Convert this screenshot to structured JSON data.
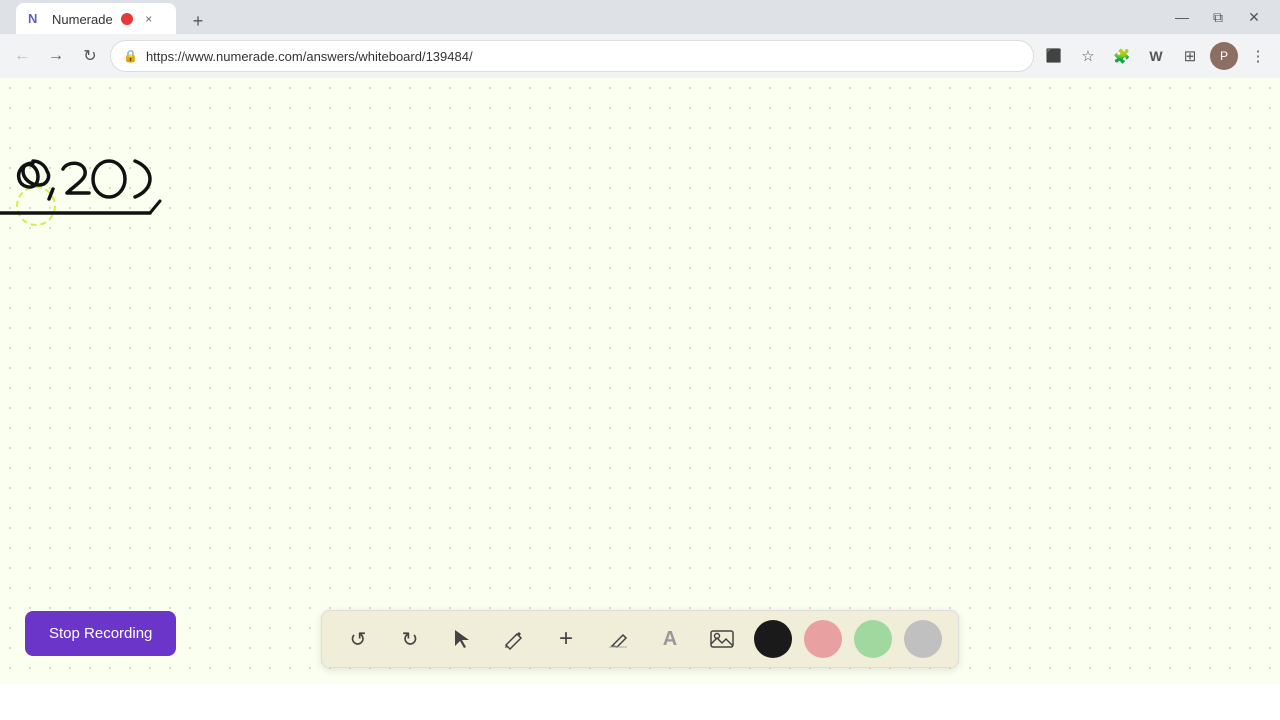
{
  "browser": {
    "tab": {
      "favicon": "N",
      "title": "Numerade",
      "recording_dot": true,
      "close_label": "×"
    },
    "new_tab_label": "+",
    "window_controls": {
      "minimize": "—",
      "maximize": "⧉",
      "close": "✕"
    },
    "nav": {
      "back_label": "←",
      "forward_label": "→",
      "reload_label": "↻",
      "url": "https://www.numerade.com/answers/whiteboard/139484/",
      "bookmark_label": "☆",
      "extensions_label": "⬡",
      "wordmark_label": "W",
      "grid_label": "⊞",
      "profile_label": "P",
      "menu_label": "⋮"
    }
  },
  "toolbar": {
    "undo_label": "↺",
    "redo_label": "↻",
    "select_label": "▲",
    "pen_label": "✏",
    "add_label": "+",
    "eraser_label": "◻",
    "text_label": "A",
    "image_label": "🖼",
    "colors": [
      {
        "name": "black",
        "hex": "#1a1a1a"
      },
      {
        "name": "pink",
        "hex": "#e8a0a0"
      },
      {
        "name": "green",
        "hex": "#a0d8a0"
      },
      {
        "name": "gray",
        "hex": "#c0c0c0"
      }
    ]
  },
  "stop_recording": {
    "label": "Stop Recording"
  },
  "page": {
    "bg_color": "#fafff0"
  }
}
